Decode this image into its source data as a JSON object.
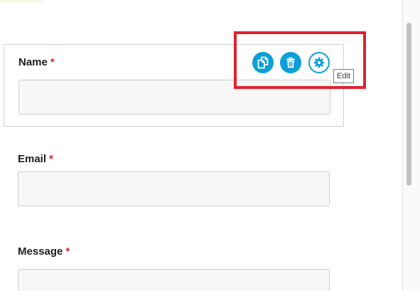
{
  "form": {
    "fields": [
      {
        "label": "Name",
        "required_marker": "*",
        "value": ""
      },
      {
        "label": "Email",
        "required_marker": "*",
        "value": ""
      },
      {
        "label": "Message",
        "required_marker": "*",
        "value": ""
      }
    ]
  },
  "toolbar": {
    "actions": [
      {
        "icon": "duplicate-icon"
      },
      {
        "icon": "trash-icon"
      },
      {
        "icon": "gear-icon"
      }
    ],
    "tooltip": "Edit"
  },
  "colors": {
    "accent": "#0c9fd8",
    "required": "#d0202a",
    "highlight": "#e0212f"
  }
}
